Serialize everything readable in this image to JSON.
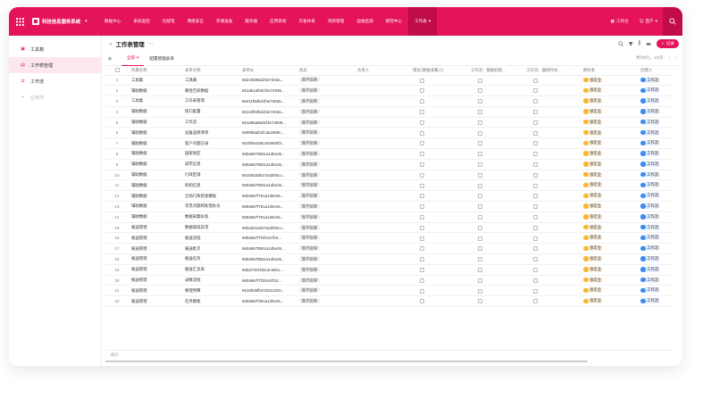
{
  "app": {
    "title": "科技信息服务系统",
    "nav": [
      "数据中心",
      "系统监控",
      "任配电",
      "网络安全",
      "存储设备",
      "服务器",
      "应用系统",
      "灾备体系",
      "项目管理",
      "运维监测",
      "研究中心",
      "工作表"
    ],
    "active_nav_index": 11,
    "right": {
      "workbench": "工作台",
      "user": "首户"
    }
  },
  "sidebar": {
    "items": [
      {
        "label": "工具箱",
        "icon": "toolbox-icon"
      },
      {
        "label": "工作表管理",
        "icon": "sheet-icon"
      },
      {
        "label": "工作流",
        "icon": "flow-icon"
      }
    ],
    "active_index": 1,
    "add_label": "应用项"
  },
  "main": {
    "title": "工作表管理",
    "add_button": "记录",
    "tabs": [
      "全部",
      "配置管理表单"
    ],
    "pager": "共计6行，1/2页",
    "footer": "统计"
  },
  "table": {
    "columns": [
      "",
      "所属名称",
      "表单名称",
      "表单ID",
      "状态",
      "负责人",
      "增加 [数据采集人]",
      "工作流：数据初始...",
      "工作流：删除时间...",
      "拥有者",
      "创建人"
    ],
    "status_text": "暂不处理",
    "owner": "张宏业",
    "creator": "工作流",
    "rows": [
      [
        "1",
        "工具集",
        "工具箱",
        "66210b86d1f4e7403a..."
      ],
      [
        "2",
        "辅助数据",
        "路径告知数据",
        "661ab1af0d1f4e74836..."
      ],
      [
        "3",
        "工具集",
        "工作表管理",
        "66211f5dbd1f4e7463a..."
      ],
      [
        "4",
        "辅助数据",
        "接口配置",
        "661c9f49bd1f4e7463a..."
      ],
      [
        "5",
        "辅助数据",
        "工作流",
        "661a96a66d1f4e74839..."
      ],
      [
        "6",
        "辅助数据",
        "设备品牌清单",
        "6606f6ad01fcda1869c..."
      ],
      [
        "7",
        "辅助数据",
        "客户问题记录",
        "661f05a3a51404660f3..."
      ],
      [
        "8",
        "辅助数据",
        "国家地区",
        "660a6578551a14be26..."
      ],
      [
        "9",
        "辅助数据",
        "城市信息",
        "660a6578551a14be26..."
      ],
      [
        "10",
        "辅助数据",
        "行政区域",
        "66100a3d527a4d0f4cc..."
      ],
      [
        "11",
        "辅助数据",
        "机构信息",
        "660a6578551a14be26..."
      ],
      [
        "12",
        "辅助数据",
        "全局行政检索模板",
        "660a657f751a14be26..."
      ],
      [
        "13",
        "辅助数据",
        "常见问题和处理办法",
        "660a657f751a14be26..."
      ],
      [
        "14",
        "辅助数据",
        "数据采集标准",
        "660a657f751a14be26..."
      ],
      [
        "15",
        "报送管理",
        "数据值班异常",
        "660ad21e527a4d0f4cc..."
      ],
      [
        "16",
        "报送管理",
        "报送流程",
        "660a657f7f1fe347b3..."
      ],
      [
        "17",
        "报送管理",
        "报送批次",
        "660a6578551a14be26..."
      ],
      [
        "18",
        "报送管理",
        "报送任务",
        "660a6578551a14be26..."
      ],
      [
        "19",
        "报送管理",
        "报送汇总表",
        "660a7201f45c3c3eb1..."
      ],
      [
        "20",
        "报送管理",
        "录数流程",
        "660a657f7f1fe347b3..."
      ],
      [
        "21",
        "报送管理",
        "要理预算",
        "6618b25ffa7d15123c0..."
      ],
      [
        "22",
        "报送管理",
        "任务模板",
        "660a657f451a14be26..."
      ]
    ]
  },
  "colors": {
    "accent": "#e5135a",
    "accent_dark": "#c00c4a"
  }
}
